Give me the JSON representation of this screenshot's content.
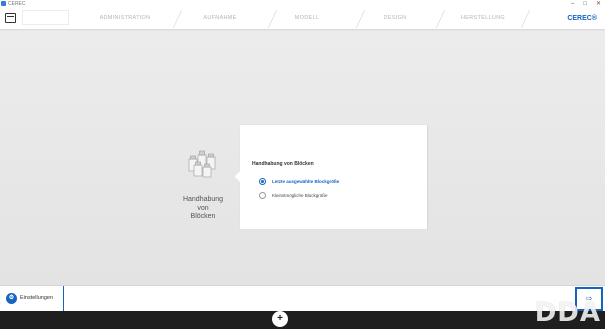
{
  "window": {
    "title": "CEREC"
  },
  "header": {
    "steps": [
      "ADMINISTRATION",
      "AUFNAHME",
      "MODELL",
      "DESIGN",
      "HERSTELLUNG"
    ],
    "brand": "CEREC®"
  },
  "card": {
    "caption_line1": "Handhabung",
    "caption_line2": "von",
    "caption_line3": "Blöcken",
    "section_title": "Handhabung von Blöcken",
    "options": [
      {
        "label": "Letzte ausgewählte Blockgröße",
        "selected": true
      },
      {
        "label": "Kleinstmögliche Blockgröße",
        "selected": false
      }
    ]
  },
  "footer": {
    "settings_label": "Einstellungen",
    "settings_icon": "settings-icon",
    "next_icon": "next-step-icon",
    "center_icon": "plus-icon"
  },
  "watermark": "DDA",
  "colors": {
    "accent": "#1565c0"
  }
}
